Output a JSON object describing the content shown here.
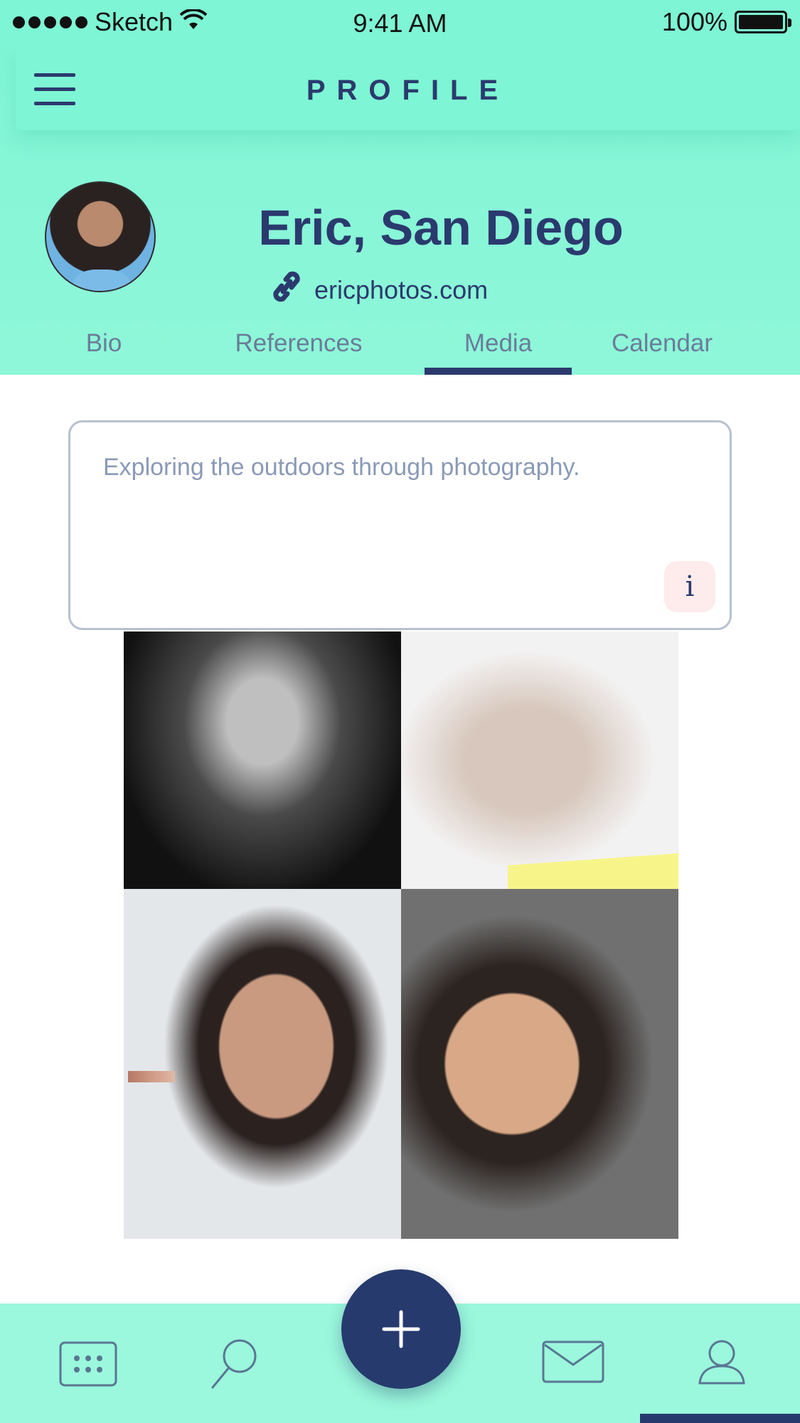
{
  "status_bar": {
    "carrier": "Sketch",
    "time": "9:41 AM",
    "battery": "100%"
  },
  "navbar": {
    "title": "PROFILE",
    "menu_icon": "hamburger-menu-icon"
  },
  "profile": {
    "name": "Eric, San Diego",
    "website": "ericphotos.com",
    "link_icon": "link-icon"
  },
  "tabs": [
    {
      "label": "Bio",
      "active": false
    },
    {
      "label": "References",
      "active": false
    },
    {
      "label": "Media",
      "active": true
    },
    {
      "label": "Calendar",
      "active": false
    }
  ],
  "bio": {
    "text": "Exploring the outdoors through photography.",
    "info_label": "i"
  },
  "media": {
    "photos": [
      "bw-profile-portrait",
      "sketch-overlay-portrait",
      "freckles-overlay-portrait",
      "lip-overlay-portrait"
    ]
  },
  "bottom_nav": {
    "items": [
      "calendar-icon",
      "search-icon",
      "add-icon",
      "mail-icon",
      "profile-icon"
    ],
    "active": "profile-icon"
  },
  "colors": {
    "header_bg": "#7ef5d4",
    "bottom_bar_bg": "#9bf8dc",
    "primary": "#2b3a6e",
    "muted_text": "#8a9ab6",
    "info_button_bg": "#fdeceb"
  }
}
